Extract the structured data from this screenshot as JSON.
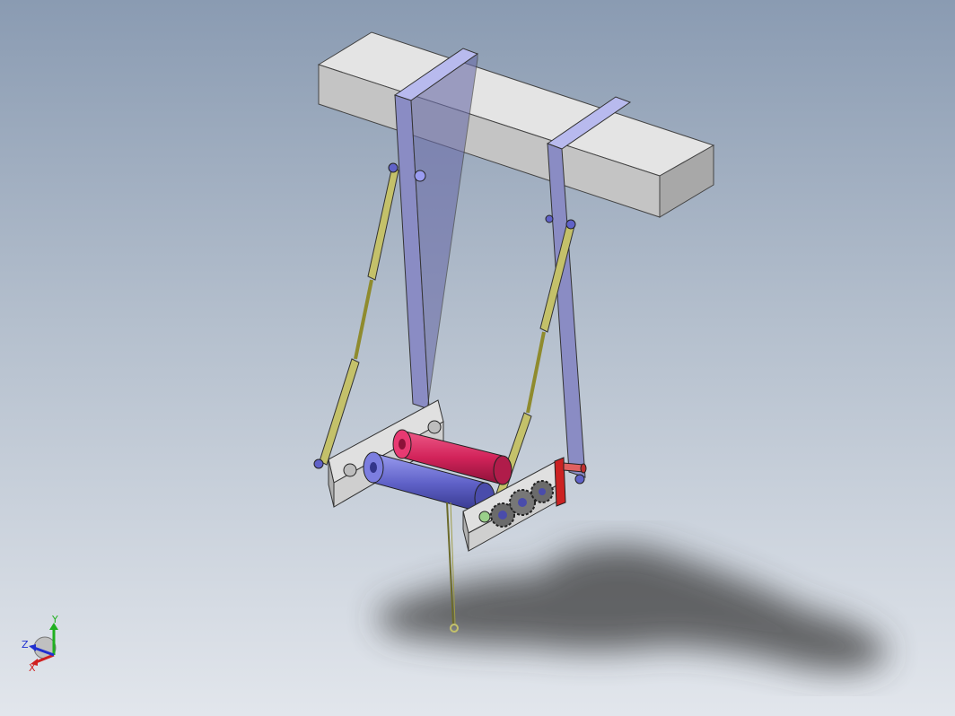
{
  "viewport": {
    "background_top": "#8a9bb2",
    "background_bottom": "#e2e6ec"
  },
  "model": {
    "beam_color": "#c7c7c7",
    "frame_color": "#8a8cc4",
    "strut_color": "#b6b35e",
    "red_roller_color": "#d2235a",
    "blue_roller_color": "#6062c8",
    "plate_color": "#cfcfcf",
    "gear_color": "#6b6b6b",
    "crank_color": "#cc2222",
    "shadow_color": "#3a3a3a"
  },
  "triad": {
    "x_label": "X",
    "y_label": "Y",
    "z_label": "Z",
    "x_color": "#d02020",
    "y_color": "#20b020",
    "z_color": "#2030d0"
  }
}
